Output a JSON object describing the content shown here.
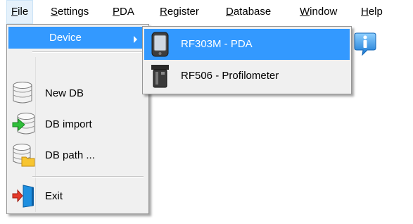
{
  "menubar": {
    "items": [
      {
        "pre": "",
        "u": "F",
        "post": "ile"
      },
      {
        "pre": "",
        "u": "S",
        "post": "ettings"
      },
      {
        "pre": "",
        "u": "P",
        "post": "DA"
      },
      {
        "pre": "",
        "u": "R",
        "post": "egister"
      },
      {
        "pre": "",
        "u": "D",
        "post": "atabase"
      },
      {
        "pre": "",
        "u": "W",
        "post": "indow"
      },
      {
        "pre": "",
        "u": "H",
        "post": "elp"
      }
    ]
  },
  "file_menu": {
    "device": "Device",
    "new_db": "New DB",
    "db_import": "DB import",
    "db_path": "DB path ...",
    "exit": "Exit"
  },
  "device_submenu": {
    "item1": "RF303M - PDA",
    "item2": "RF506 - Profilometer"
  },
  "icons": {
    "new_db": "database-new-icon",
    "db_import": "database-import-icon",
    "db_path": "database-folder-icon",
    "exit": "exit-door-icon",
    "pda": "pda-device-icon",
    "profilometer": "profilometer-device-icon",
    "info": "info-icon"
  },
  "colors": {
    "highlight": "#3399ff",
    "menu_bg": "#f0f0f0"
  }
}
